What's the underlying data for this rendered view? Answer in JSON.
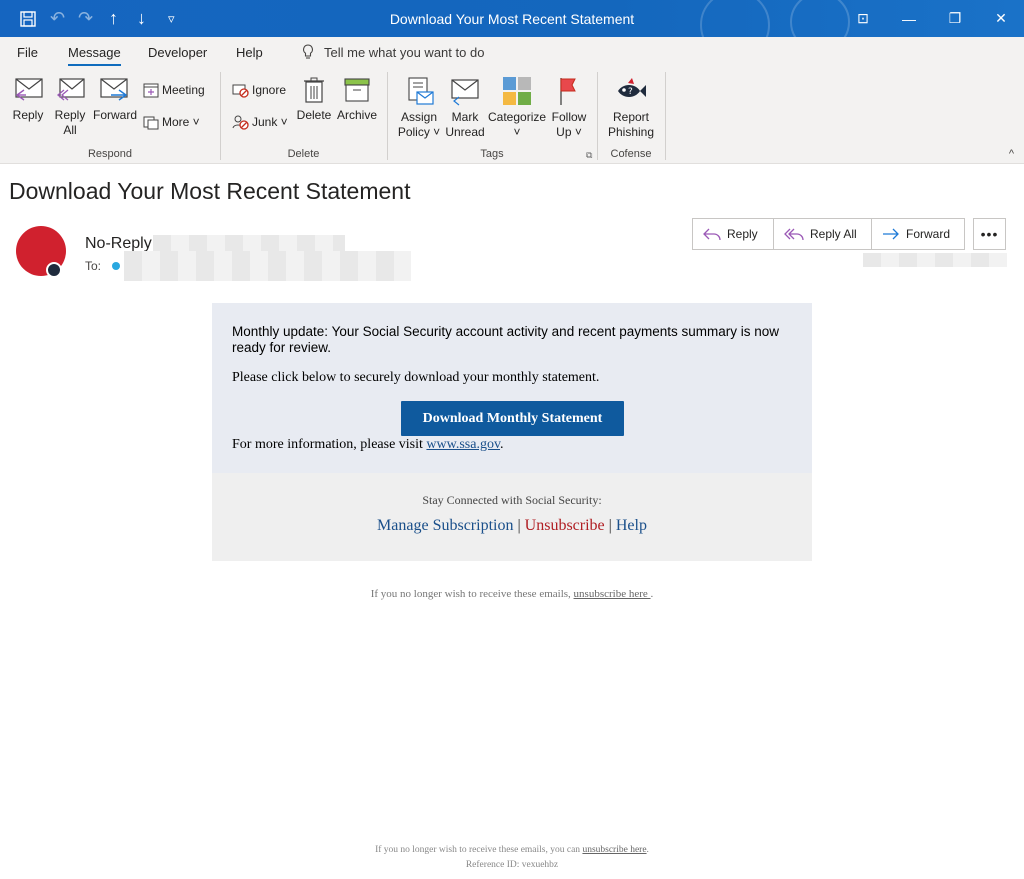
{
  "window": {
    "title": "Download Your Most Recent Statement",
    "controls": {
      "restore_ribbon": "⊡",
      "minimize": "—",
      "maximize": "❐",
      "close": "✕"
    }
  },
  "quick_access": {
    "save": "🖫",
    "undo": "↶",
    "redo": "↷",
    "up": "↑",
    "down": "↓",
    "customize": "▿"
  },
  "menu": {
    "tabs": [
      "File",
      "Message",
      "Developer",
      "Help"
    ],
    "active_tab": "Message",
    "tell_me": "Tell me what you want to do"
  },
  "ribbon": {
    "respond": {
      "label": "Respond",
      "reply": "Reply",
      "reply_all_1": "Reply",
      "reply_all_2": "All",
      "forward": "Forward",
      "meeting": "Meeting",
      "more": "More ˅"
    },
    "delete": {
      "label": "Delete",
      "ignore": "Ignore",
      "junk": "Junk ˅",
      "delete": "Delete",
      "archive": "Archive"
    },
    "tags": {
      "label": "Tags",
      "assign_1": "Assign",
      "assign_2": "Policy ˅",
      "mark_1": "Mark",
      "mark_2": "Unread",
      "categorize_1": "Categorize",
      "categorize_2": "˅",
      "follow_1": "Follow",
      "follow_2": "Up ˅"
    },
    "cofense": {
      "label": "Cofense",
      "report_1": "Report",
      "report_2": "Phishing"
    },
    "collapse": "^"
  },
  "message": {
    "subject": "Download Your Most Recent Statement",
    "sender": "No-Reply",
    "to_label": "To:",
    "actions": {
      "reply": "Reply",
      "reply_all": "Reply All",
      "forward": "Forward",
      "more": "•••"
    }
  },
  "body": {
    "intro": "Monthly update: Your Social Security account activity and recent payments summary is now ready for review.",
    "instruction": "Please click below to securely download your monthly statement.",
    "button": "Download Monthly Statement",
    "more_info_prefix": "For more information, please visit ",
    "more_info_link": "www.ssa.gov",
    "more_info_suffix": ".",
    "stay_connected": "Stay Connected with Social Security:",
    "manage": "Manage Subscription",
    "pipe1": " | ",
    "unsubscribe": "Unsubscribe",
    "pipe2": " | ",
    "help": "Help",
    "note1_prefix": "If you no longer wish to receive these emails, ",
    "note1_link": "unsubscribe here ",
    "note1_suffix": ".",
    "note2_prefix": "If you no longer wish to receive these emails, you can ",
    "note2_link": "unsubscribe here",
    "note2_suffix": ".",
    "reference": "Reference ID: vexuehbz"
  },
  "colors": {
    "titlebar": "#1565c0",
    "avatar": "#d0212e",
    "button": "#0f5a9e",
    "link": "#1a4f8a",
    "unsubscribe": "#b01e23"
  }
}
